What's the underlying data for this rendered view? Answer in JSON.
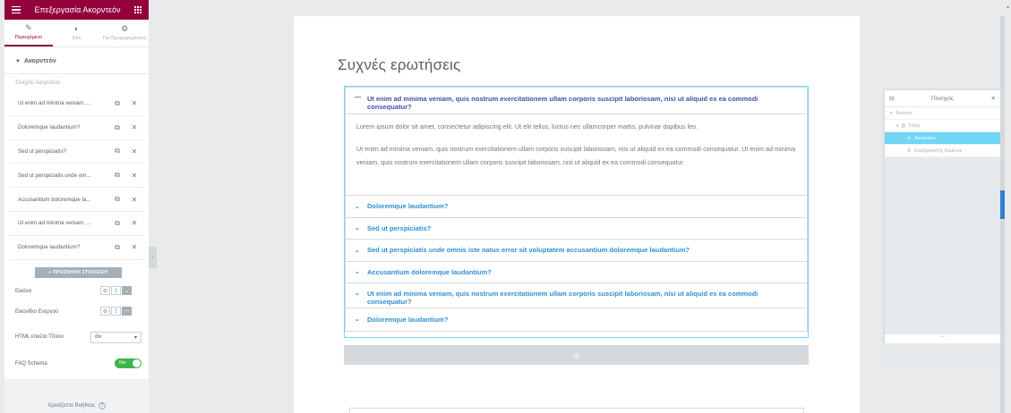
{
  "editor": {
    "title": "Επεξεργασία Ακορντεόν",
    "tabs": [
      {
        "label": "Περιεχόμενο",
        "icon": "pencil-icon"
      },
      {
        "label": "Στιλ",
        "icon": "half-circle-icon"
      },
      {
        "label": "Για Προχωρημένους",
        "icon": "gear-icon"
      }
    ],
    "section_title": "Ακορντεόν",
    "items_label": "Στοιχεία Ακορντεόν",
    "items": [
      "Ut enim ad minima veniam, ...",
      "Doloremque laudantium?",
      "Sed ut perspiciatis?",
      "Sed ut perspiciatis unde om...",
      "Accusantium doloremque la...",
      "Ut enim ad minima veniam, ...",
      "Doloremque laudantium?"
    ],
    "add_button": "+ ΠΡΟΣΘΗΚΗ ΣΤΟΙΧΕΙΟΥ",
    "icon_label": "Εικόνα",
    "active_icon_label": "Εικονίδιο Ενεργού",
    "html_tag_label": "HTML ετικέτα Τίτλου",
    "html_tag_value": "div",
    "faq_schema_label": "FAQ Schema",
    "faq_schema_toggle": "Ναι",
    "help_text": "Χρειάζεστε Βοήθεια;"
  },
  "canvas": {
    "heading": "Συχνές ερωτήσεις",
    "accordion": [
      {
        "title": "Ut enim ad minima veniam, quis nostrum exercitationem ullam corporis suscipit laboriosam, nisi ut aliquid ex ea commodi consequatur?",
        "open": true
      },
      {
        "title": "Doloremque laudantium?"
      },
      {
        "title": "Sed ut perspiciatis?"
      },
      {
        "title": "Sed ut perspiciatis unde omnis iste natus error sit voluptatem accusantium doloremque laudantium?"
      },
      {
        "title": "Accusantium doloremque laudantium?"
      },
      {
        "title": "Ut enim ad minima veniam, quis nostrum exercitationem ullam corporis suscipit laboriosam, nisi ut aliquid ex ea commodi consequatur?"
      },
      {
        "title": "Doloremque laudantium?"
      }
    ],
    "open_body": [
      "Lorem ipsum dolor sit amet, consectetur adipiscing elit. Ut elit tellus, luctus nec ullamcorper mattis, pulvinar dapibus leo.",
      "Ut enim ad minima veniam, quis nostrum exercitationem ullam corporis suscipit laboriosam, nisi ut aliquid ex ea commodi consequatur. Ut enim ad minima veniam, quis nostrum exercitationem ullam corporis suscipit laboriosam, nisi ut aliquid ex ea commodi consequatur"
    ]
  },
  "navigator": {
    "title": "Πλοηγός",
    "rows": [
      {
        "label": "Ενότητα"
      },
      {
        "label": "Στήλη"
      },
      {
        "label": "Ακορντεόν"
      },
      {
        "label": "Επεξεργαστής Κειμένου"
      }
    ]
  },
  "colors": {
    "brand": "#93003c",
    "accent": "#71d7f7",
    "link": "#2e8fd6",
    "toggle_on": "#39b54a"
  }
}
